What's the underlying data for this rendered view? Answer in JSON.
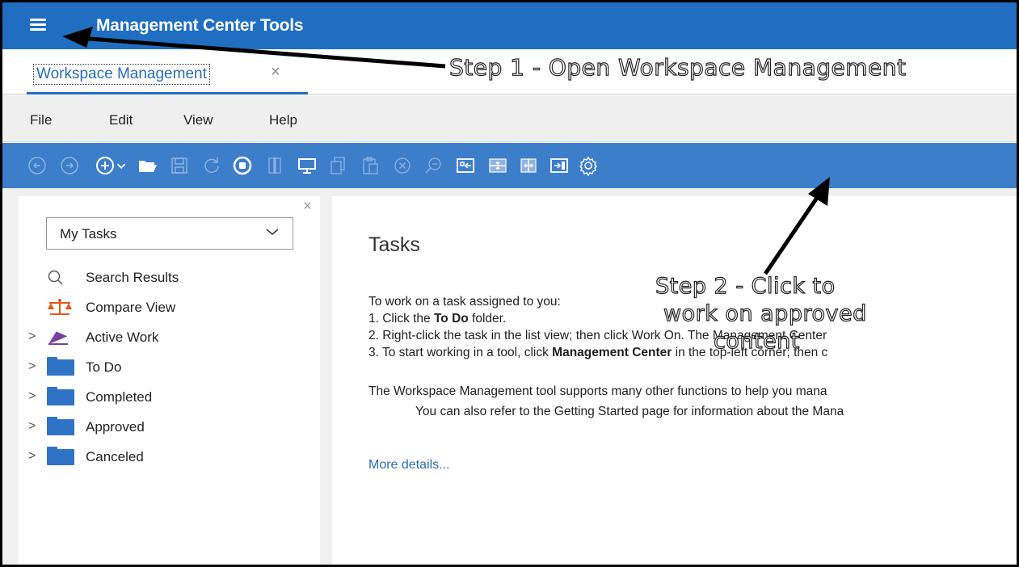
{
  "app": {
    "title": "Management Center Tools"
  },
  "tabs": [
    {
      "label": "Workspace Management",
      "close": "×"
    }
  ],
  "annotations": {
    "step1": "Step 1 - Open Workspace Management",
    "step2_line1": "Step 2 - Click to",
    "step2_line2": "work on approved",
    "step2_line3": "content"
  },
  "menu": {
    "file": "File",
    "edit": "Edit",
    "view": "View",
    "help": "Help"
  },
  "toolbar": {
    "icons": [
      "back-icon",
      "forward-icon",
      "add-icon",
      "open-folder-icon",
      "save-icon",
      "refresh-icon",
      "stop-icon",
      "columns-icon",
      "monitor-icon",
      "copy-icon",
      "paste-icon",
      "cancel-icon",
      "find-icon",
      "restore-icon",
      "collapse-icon",
      "expand-icon",
      "maximize-icon",
      "workspace-gear-icon"
    ]
  },
  "left_pane": {
    "close": "×",
    "dropdown_value": "My Tasks",
    "items": [
      {
        "label": "Search Results",
        "icon": "search-icon"
      },
      {
        "label": "Compare View",
        "icon": "compare-icon"
      },
      {
        "label": "Active Work",
        "icon": "active-work-icon",
        "expandable": true
      },
      {
        "label": "To Do",
        "icon": "folder-icon",
        "expandable": true
      },
      {
        "label": "Completed",
        "icon": "folder-icon",
        "expandable": true
      },
      {
        "label": "Approved",
        "icon": "folder-icon",
        "expandable": true
      },
      {
        "label": "Canceled",
        "icon": "folder-icon",
        "expandable": true
      }
    ],
    "expand_glyph": ">"
  },
  "right_pane": {
    "title": "Tasks",
    "intro": "To work on a task assigned to you:",
    "step1_prefix": "1. Click the ",
    "step1_bold": "To Do",
    "step1_suffix": " folder.",
    "step2_text": "2. Right-click the task in the list view; then click Work On. The Management Center",
    "step3_prefix": "3. To start working in a tool, click ",
    "step3_bold": "Management Center",
    "step3_suffix": " in the top-left corner; then c",
    "para2": "The Workspace Management tool supports many other functions to help you mana",
    "para3": "You can also refer to the Getting Started page for information about the Mana",
    "more_link": "More details..."
  },
  "colors": {
    "titlebar": "#1f6ec2",
    "toolbar": "#3d7ecb",
    "folder": "#2f73c6",
    "link": "#2a6cb8"
  }
}
